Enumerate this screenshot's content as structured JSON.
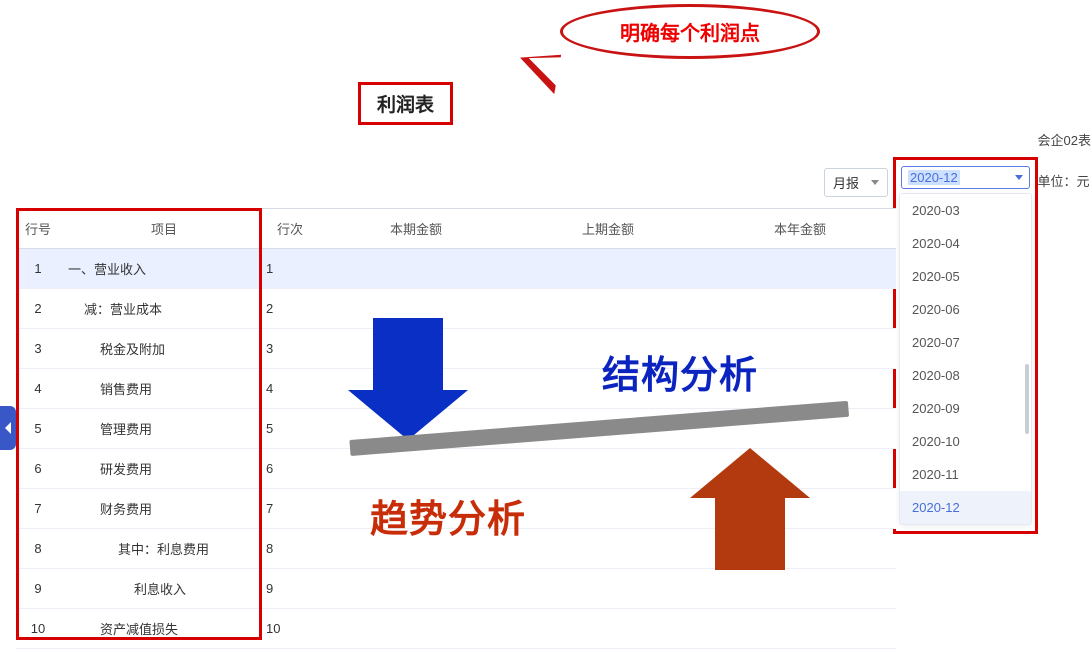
{
  "callout": "明确每个利润点",
  "title": "利润表",
  "meta": {
    "form_code": "会企02表",
    "unit_label": "单位：元"
  },
  "report_type": {
    "label": "月报"
  },
  "period": {
    "selected": "2020-12",
    "options": [
      "2020-03",
      "2020-04",
      "2020-05",
      "2020-06",
      "2020-07",
      "2020-08",
      "2020-09",
      "2020-10",
      "2020-11",
      "2020-12"
    ]
  },
  "headers": {
    "row_no": "行号",
    "item": "项目",
    "line": "行次",
    "cur": "本期金额",
    "prev": "上期金额",
    "ytd": "本年金额"
  },
  "rows": [
    {
      "no": "1",
      "item": "一、营业收入",
      "line": "1",
      "cls": "hl"
    },
    {
      "no": "2",
      "item": "减：营业成本",
      "line": "2",
      "cls": "indent1"
    },
    {
      "no": "3",
      "item": "税金及附加",
      "line": "3",
      "cls": "indent2"
    },
    {
      "no": "4",
      "item": "销售费用",
      "line": "4",
      "cls": "indent2"
    },
    {
      "no": "5",
      "item": "管理费用",
      "line": "5",
      "cls": "indent2"
    },
    {
      "no": "6",
      "item": "研发费用",
      "line": "6",
      "cls": "indent2"
    },
    {
      "no": "7",
      "item": "财务费用",
      "line": "7",
      "cls": "indent2"
    },
    {
      "no": "8",
      "item": "其中：利息费用",
      "line": "8",
      "cls": "indent3"
    },
    {
      "no": "9",
      "item": "利息收入",
      "line": "9",
      "cls": "indent4"
    },
    {
      "no": "10",
      "item": "资产减值损失",
      "line": "10",
      "cls": "indent2"
    }
  ],
  "labels": {
    "structure": "结构分析",
    "trend": "趋势分析"
  }
}
